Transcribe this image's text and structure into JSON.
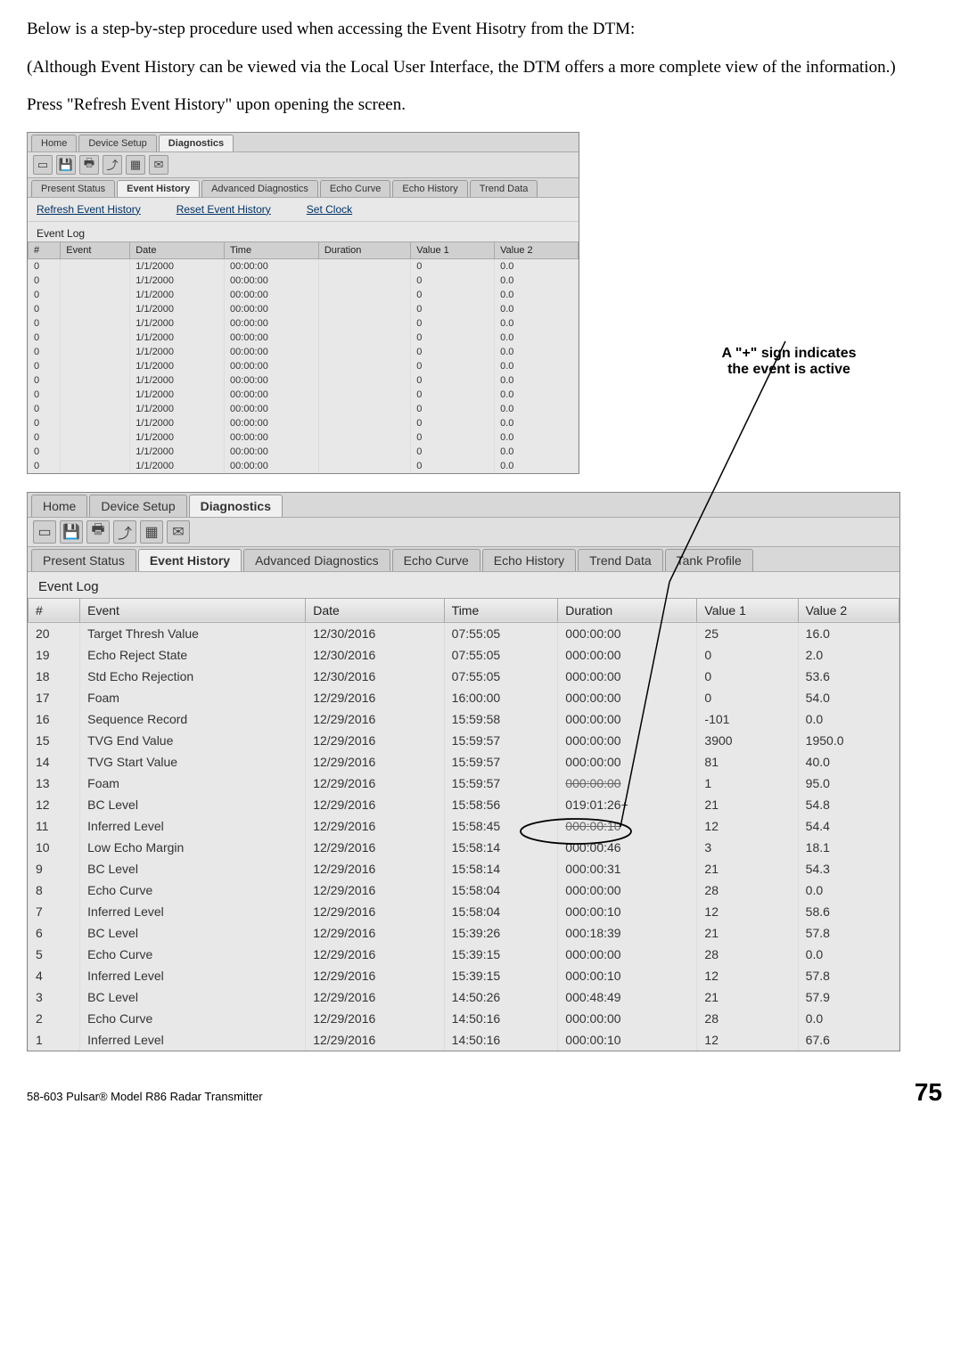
{
  "text": {
    "intro1": "Below is a step-by-step procedure used when accessing the Event Hisotry from the DTM:",
    "intro2": "(Although Event History can be viewed via the Local User Interface, the DTM offers a more complete view of the information.)",
    "intro3": "Press \"Refresh Event History\" upon opening the screen.",
    "callout_line1": "A \"+\" sign indicates",
    "callout_line2": "the event is active"
  },
  "footer": {
    "left": "58-603 Pulsar® Model R86 Radar Transmitter",
    "page": "75"
  },
  "small_screenshot": {
    "top_tabs": [
      "Home",
      "Device Setup",
      "Diagnostics"
    ],
    "top_active": 2,
    "sub_tabs": [
      "Present Status",
      "Event History",
      "Advanced Diagnostics",
      "Echo Curve",
      "Echo History",
      "Trend Data"
    ],
    "sub_active": 1,
    "actions": [
      "Refresh Event History",
      "Reset Event History",
      "Set Clock"
    ],
    "log_title": "Event Log",
    "columns": [
      "#",
      "Event",
      "Date",
      "Time",
      "Duration",
      "Value 1",
      "Value 2"
    ],
    "rows": [
      {
        "n": "0",
        "event": "",
        "date": "1/1/2000",
        "time": "00:00:00",
        "dur": "",
        "v1": "0",
        "v2": "0.0"
      },
      {
        "n": "0",
        "event": "",
        "date": "1/1/2000",
        "time": "00:00:00",
        "dur": "",
        "v1": "0",
        "v2": "0.0"
      },
      {
        "n": "0",
        "event": "",
        "date": "1/1/2000",
        "time": "00:00:00",
        "dur": "",
        "v1": "0",
        "v2": "0.0"
      },
      {
        "n": "0",
        "event": "",
        "date": "1/1/2000",
        "time": "00:00:00",
        "dur": "",
        "v1": "0",
        "v2": "0.0"
      },
      {
        "n": "0",
        "event": "",
        "date": "1/1/2000",
        "time": "00:00:00",
        "dur": "",
        "v1": "0",
        "v2": "0.0"
      },
      {
        "n": "0",
        "event": "",
        "date": "1/1/2000",
        "time": "00:00:00",
        "dur": "",
        "v1": "0",
        "v2": "0.0"
      },
      {
        "n": "0",
        "event": "",
        "date": "1/1/2000",
        "time": "00:00:00",
        "dur": "",
        "v1": "0",
        "v2": "0.0"
      },
      {
        "n": "0",
        "event": "",
        "date": "1/1/2000",
        "time": "00:00:00",
        "dur": "",
        "v1": "0",
        "v2": "0.0"
      },
      {
        "n": "0",
        "event": "",
        "date": "1/1/2000",
        "time": "00:00:00",
        "dur": "",
        "v1": "0",
        "v2": "0.0"
      },
      {
        "n": "0",
        "event": "",
        "date": "1/1/2000",
        "time": "00:00:00",
        "dur": "",
        "v1": "0",
        "v2": "0.0"
      },
      {
        "n": "0",
        "event": "",
        "date": "1/1/2000",
        "time": "00:00:00",
        "dur": "",
        "v1": "0",
        "v2": "0.0"
      },
      {
        "n": "0",
        "event": "",
        "date": "1/1/2000",
        "time": "00:00:00",
        "dur": "",
        "v1": "0",
        "v2": "0.0"
      },
      {
        "n": "0",
        "event": "",
        "date": "1/1/2000",
        "time": "00:00:00",
        "dur": "",
        "v1": "0",
        "v2": "0.0"
      },
      {
        "n": "0",
        "event": "",
        "date": "1/1/2000",
        "time": "00:00:00",
        "dur": "",
        "v1": "0",
        "v2": "0.0"
      },
      {
        "n": "0",
        "event": "",
        "date": "1/1/2000",
        "time": "00:00:00",
        "dur": "",
        "v1": "0",
        "v2": "0.0"
      }
    ]
  },
  "big_screenshot": {
    "top_tabs": [
      "Home",
      "Device Setup",
      "Diagnostics"
    ],
    "top_active": 2,
    "sub_tabs": [
      "Present Status",
      "Event History",
      "Advanced Diagnostics",
      "Echo Curve",
      "Echo History",
      "Trend Data",
      "Tank Profile"
    ],
    "sub_active": 1,
    "log_title": "Event Log",
    "columns": [
      "#",
      "Event",
      "Date",
      "Time",
      "Duration",
      "Value 1",
      "Value 2"
    ],
    "rows": [
      {
        "n": "20",
        "event": "Target Thresh Value",
        "date": "12/30/2016",
        "time": "07:55:05",
        "dur": "000:00:00",
        "v1": "25",
        "v2": "16.0"
      },
      {
        "n": "19",
        "event": "Echo Reject State",
        "date": "12/30/2016",
        "time": "07:55:05",
        "dur": "000:00:00",
        "v1": "0",
        "v2": "2.0"
      },
      {
        "n": "18",
        "event": "Std Echo Rejection",
        "date": "12/30/2016",
        "time": "07:55:05",
        "dur": "000:00:00",
        "v1": "0",
        "v2": "53.6"
      },
      {
        "n": "17",
        "event": "Foam",
        "date": "12/29/2016",
        "time": "16:00:00",
        "dur": "000:00:00",
        "v1": "0",
        "v2": "54.0"
      },
      {
        "n": "16",
        "event": "Sequence Record",
        "date": "12/29/2016",
        "time": "15:59:58",
        "dur": "000:00:00",
        "v1": "-101",
        "v2": "0.0"
      },
      {
        "n": "15",
        "event": "TVG End Value",
        "date": "12/29/2016",
        "time": "15:59:57",
        "dur": "000:00:00",
        "v1": "3900",
        "v2": "1950.0"
      },
      {
        "n": "14",
        "event": "TVG Start Value",
        "date": "12/29/2016",
        "time": "15:59:57",
        "dur": "000:00:00",
        "v1": "81",
        "v2": "40.0"
      },
      {
        "n": "13",
        "event": "Foam",
        "date": "12/29/2016",
        "time": "15:59:57",
        "dur": "000:00:00",
        "v1": "1",
        "v2": "95.0",
        "strike_dur": true
      },
      {
        "n": "12",
        "event": "BC Level",
        "date": "12/29/2016",
        "time": "15:58:56",
        "dur": "019:01:26+",
        "v1": "21",
        "v2": "54.8",
        "circled": true
      },
      {
        "n": "11",
        "event": "Inferred Level",
        "date": "12/29/2016",
        "time": "15:58:45",
        "dur": "000:00:10",
        "v1": "12",
        "v2": "54.4",
        "strike_dur": true
      },
      {
        "n": "10",
        "event": "Low Echo Margin",
        "date": "12/29/2016",
        "time": "15:58:14",
        "dur": "000:00:46",
        "v1": "3",
        "v2": "18.1"
      },
      {
        "n": "9",
        "event": "BC Level",
        "date": "12/29/2016",
        "time": "15:58:14",
        "dur": "000:00:31",
        "v1": "21",
        "v2": "54.3"
      },
      {
        "n": "8",
        "event": "Echo Curve",
        "date": "12/29/2016",
        "time": "15:58:04",
        "dur": "000:00:00",
        "v1": "28",
        "v2": "0.0"
      },
      {
        "n": "7",
        "event": "Inferred Level",
        "date": "12/29/2016",
        "time": "15:58:04",
        "dur": "000:00:10",
        "v1": "12",
        "v2": "58.6"
      },
      {
        "n": "6",
        "event": "BC Level",
        "date": "12/29/2016",
        "time": "15:39:26",
        "dur": "000:18:39",
        "v1": "21",
        "v2": "57.8"
      },
      {
        "n": "5",
        "event": "Echo Curve",
        "date": "12/29/2016",
        "time": "15:39:15",
        "dur": "000:00:00",
        "v1": "28",
        "v2": "0.0"
      },
      {
        "n": "4",
        "event": "Inferred Level",
        "date": "12/29/2016",
        "time": "15:39:15",
        "dur": "000:00:10",
        "v1": "12",
        "v2": "57.8"
      },
      {
        "n": "3",
        "event": "BC Level",
        "date": "12/29/2016",
        "time": "14:50:26",
        "dur": "000:48:49",
        "v1": "21",
        "v2": "57.9"
      },
      {
        "n": "2",
        "event": "Echo Curve",
        "date": "12/29/2016",
        "time": "14:50:16",
        "dur": "000:00:00",
        "v1": "28",
        "v2": "0.0"
      },
      {
        "n": "1",
        "event": "Inferred Level",
        "date": "12/29/2016",
        "time": "14:50:16",
        "dur": "000:00:10",
        "v1": "12",
        "v2": "67.6"
      }
    ]
  },
  "icons": {
    "save": "💾",
    "print": "🖶",
    "up": "⤴",
    "grid": "▦",
    "mail": "✉"
  }
}
